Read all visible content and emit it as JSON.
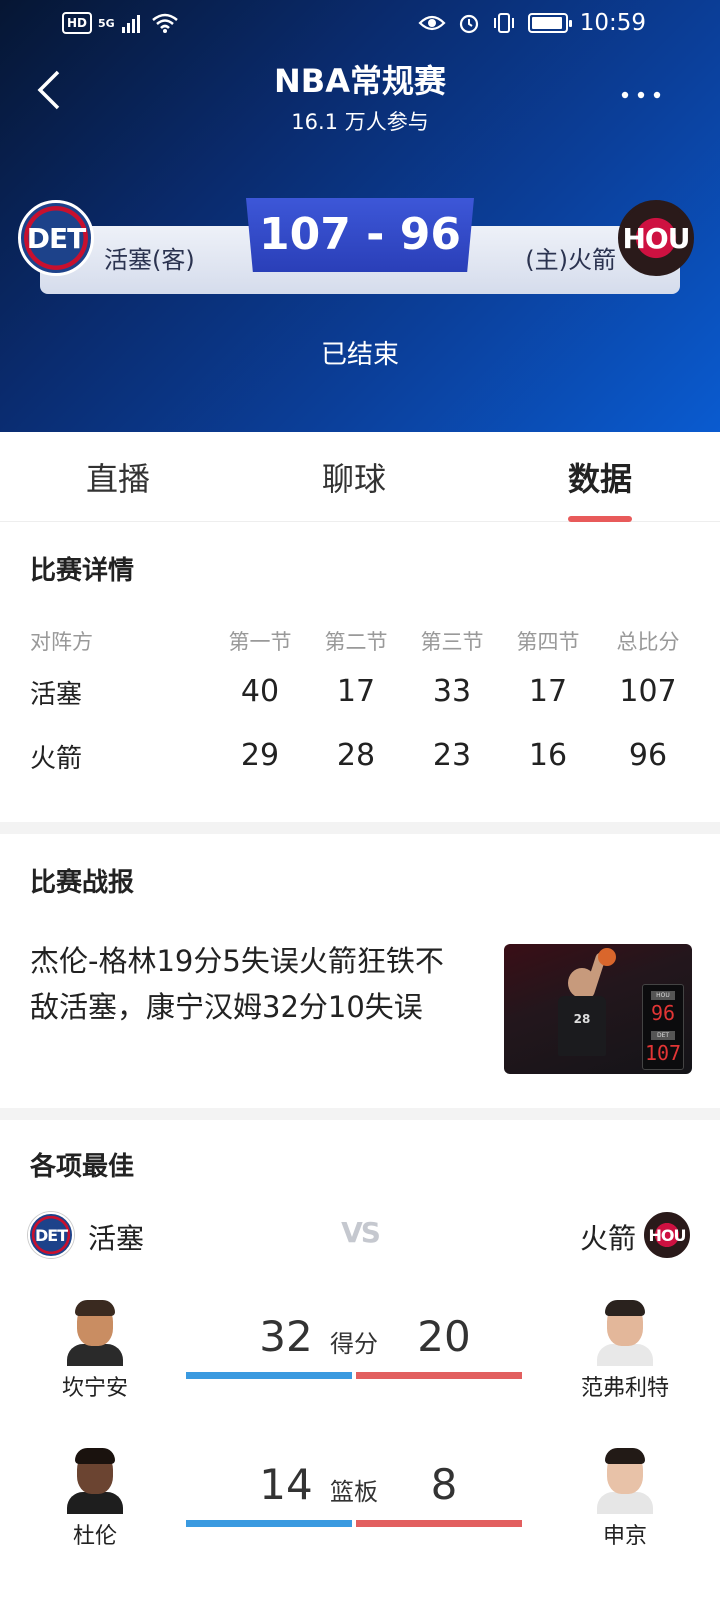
{
  "status_bar": {
    "left_badge": "HD",
    "network": "5G",
    "time": "10:59"
  },
  "header": {
    "title": "NBA常规赛",
    "subtitle": "16.1 万人参与",
    "score": "107 - 96",
    "away_label": "活塞(客)",
    "home_label": "(主)火箭",
    "away_logo_text": "DET",
    "home_logo_text": "HOU",
    "status": "已结束"
  },
  "tabs": {
    "live": "直播",
    "chat": "聊球",
    "stats": "数据"
  },
  "details": {
    "title": "比赛详情",
    "headers": [
      "对阵方",
      "第一节",
      "第二节",
      "第三节",
      "第四节",
      "总比分"
    ],
    "rows": [
      {
        "team": "活塞",
        "q1": "40",
        "q2": "17",
        "q3": "33",
        "q4": "17",
        "total": "107"
      },
      {
        "team": "火箭",
        "q1": "29",
        "q2": "28",
        "q3": "23",
        "q4": "16",
        "total": "96"
      }
    ]
  },
  "report": {
    "title": "比赛战报",
    "headline": "杰伦-格林19分5失误火箭狂铁不敌活塞，康宁汉姆32分10失误",
    "thumb_jersey_number": "28",
    "thumb_scoreboard": {
      "top_label": "HOU",
      "top_score": "96",
      "bottom_label": "DET",
      "bottom_score": "107"
    }
  },
  "leaders": {
    "title": "各项最佳",
    "left_team": "活塞",
    "right_team": "火箭",
    "vs": "VS",
    "left_logo_text": "DET",
    "right_logo_text": "HOU",
    "stats": [
      {
        "label": "得分",
        "left_value": "32",
        "right_value": "20",
        "left_player": "坎宁安",
        "right_player": "范弗利特"
      },
      {
        "label": "篮板",
        "left_value": "14",
        "right_value": "8",
        "left_player": "杜伦",
        "right_player": "申京"
      }
    ]
  },
  "colors": {
    "accent_tab_underline": "#e85a5a",
    "bar_left": "#3a9ae0",
    "bar_right": "#e25f5f",
    "score_box": "#2f47c4"
  }
}
